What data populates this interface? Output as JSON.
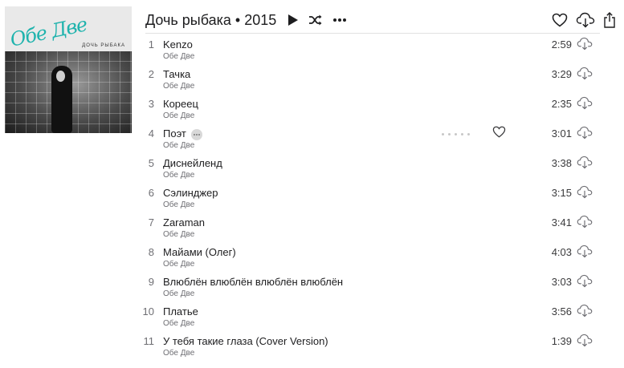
{
  "cover": {
    "brand_text": "Обе Две",
    "subtitle": "ДОЧЬ РЫБАКА"
  },
  "album": {
    "title": "Дочь рыбака • 2015"
  },
  "icons": {
    "play": "play-icon",
    "shuffle": "shuffle-icon",
    "more": "more-icon",
    "love": "heart-icon",
    "download": "cloud-download-icon",
    "share": "share-icon"
  },
  "colors": {
    "accent": "#1fb3ad",
    "text": "#1d1d1f",
    "secondary": "#6e6e73"
  },
  "tracks": [
    {
      "num": "1",
      "title": "Kenzo",
      "artist": "Обе Две",
      "duration": "2:59"
    },
    {
      "num": "2",
      "title": "Тачка",
      "artist": "Обе Две",
      "duration": "3:29"
    },
    {
      "num": "3",
      "title": "Кореец",
      "artist": "Обе Две",
      "duration": "2:35"
    },
    {
      "num": "4",
      "title": "Поэт",
      "artist": "Обе Две",
      "duration": "3:01",
      "hover": true
    },
    {
      "num": "5",
      "title": "Диснейленд",
      "artist": "Обе Две",
      "duration": "3:38"
    },
    {
      "num": "6",
      "title": "Сэлинджер",
      "artist": "Обе Две",
      "duration": "3:15"
    },
    {
      "num": "7",
      "title": "Zaraman",
      "artist": "Обе Две",
      "duration": "3:41"
    },
    {
      "num": "8",
      "title": "Майами (Олег)",
      "artist": "Обе Две",
      "duration": "4:03"
    },
    {
      "num": "9",
      "title": "Влюблён влюблён влюблён влюблён",
      "artist": "Обе Две",
      "duration": "3:03"
    },
    {
      "num": "10",
      "title": "Платье",
      "artist": "Обе Две",
      "duration": "3:56"
    },
    {
      "num": "11",
      "title": "У тебя такие глаза (Cover Version)",
      "artist": "Обе Две",
      "duration": "1:39"
    }
  ]
}
